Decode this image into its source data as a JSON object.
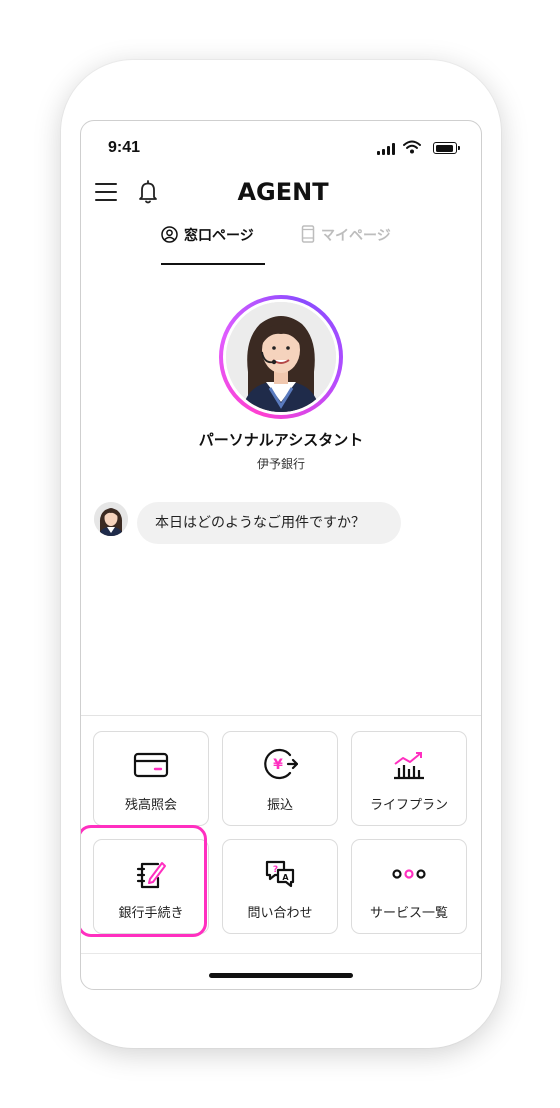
{
  "status_bar": {
    "time": "9:41"
  },
  "header": {
    "logo": "AGENT"
  },
  "tabs": [
    {
      "label": "窓口ページ",
      "active": true
    },
    {
      "label": "マイページ",
      "active": false
    }
  ],
  "agent": {
    "name": "パーソナルアシスタント",
    "bank": "伊予銀行"
  },
  "chat": {
    "message": "本日はどのようなご用件ですか？"
  },
  "menu": [
    {
      "label": "残高照会",
      "icon": "card-icon"
    },
    {
      "label": "振込",
      "icon": "yen-transfer-icon"
    },
    {
      "label": "ライフプラン",
      "icon": "growth-chart-icon"
    },
    {
      "label": "銀行手続き",
      "icon": "notebook-pen-icon",
      "highlighted": true
    },
    {
      "label": "問い合わせ",
      "icon": "chat-bubbles-icon"
    },
    {
      "label": "サービス一覧",
      "icon": "more-dots-icon"
    }
  ],
  "colors": {
    "accent": "#ff2fc0",
    "accent_purple": "#a45bff",
    "text": "#111111"
  }
}
